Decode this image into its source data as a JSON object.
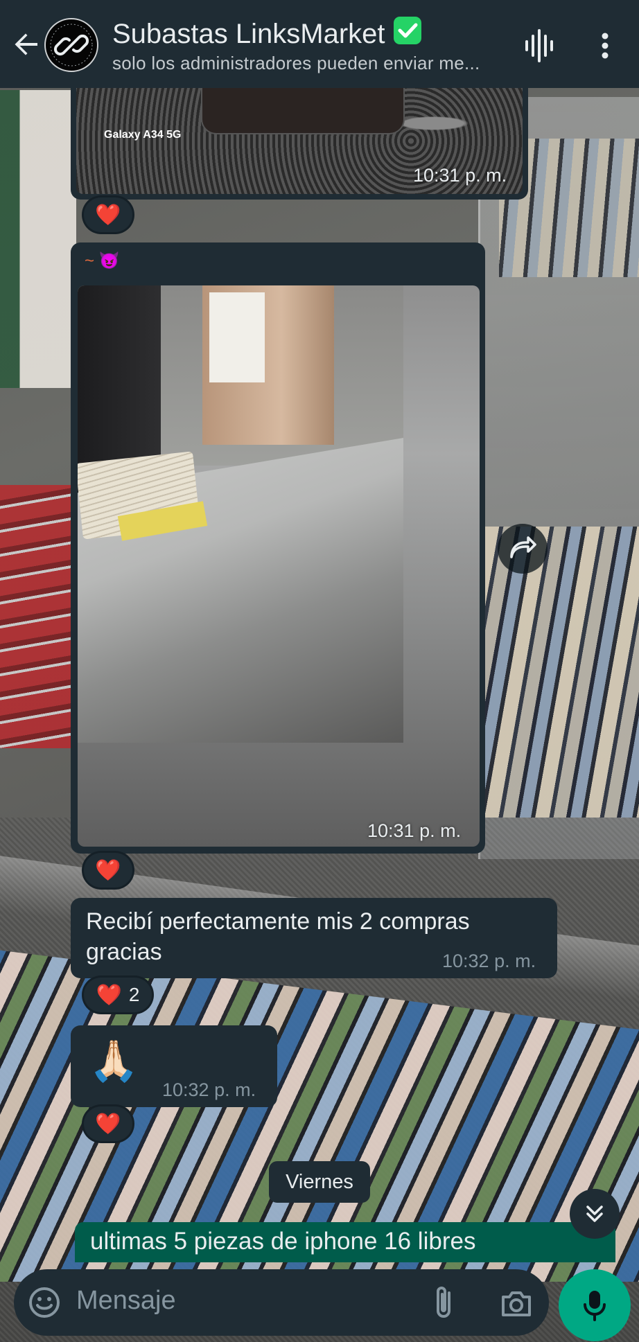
{
  "header": {
    "title": "Subastas LinksMarket",
    "subtitle": "solo los administradores pueden enviar me...",
    "icons": [
      "back-arrow-icon",
      "group-avatar",
      "verified-icon",
      "voice-call-icon",
      "more-options-icon"
    ]
  },
  "messages": [
    {
      "type": "image",
      "image_caption_text": "Galaxy A34 5G",
      "time": "10:31 p. m.",
      "reaction": {
        "emoji": "❤️",
        "count": ""
      }
    },
    {
      "type": "image",
      "sender": "~ 😈",
      "time": "10:31 p. m.",
      "reaction": {
        "emoji": "❤️",
        "count": ""
      }
    },
    {
      "type": "text",
      "text": "Recibí perfectamente mis 2 compras gracias",
      "time": "10:32 p. m.",
      "reaction": {
        "emoji": "❤️",
        "count": "2"
      }
    },
    {
      "type": "emoji",
      "text": "🙏🏻",
      "time": "10:32 p. m.",
      "reaction": {
        "emoji": "❤️",
        "count": ""
      }
    }
  ],
  "day_separator": "Viernes",
  "pinned_preview": "ultimas 5 piezas de iphone 16 libres",
  "composer": {
    "placeholder": "Mensaje"
  },
  "colors": {
    "header_bg": "#1f2c34",
    "bubble_bg": "#1f2c34",
    "accent_green": "#00a884",
    "outgoing_green": "#005c4b",
    "verified_green": "#25d366",
    "sender_color": "#e26a3e"
  }
}
